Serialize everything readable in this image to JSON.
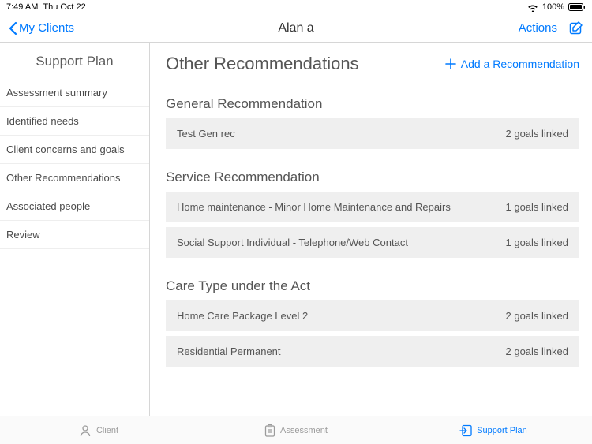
{
  "status": {
    "time": "7:49 AM",
    "date": "Thu Oct 22",
    "battery_pct": "100%"
  },
  "nav": {
    "back_label": "My Clients",
    "title": "Alan a",
    "actions_label": "Actions"
  },
  "sidebar": {
    "title": "Support Plan",
    "items": [
      {
        "label": "Assessment summary"
      },
      {
        "label": "Identified needs"
      },
      {
        "label": "Client concerns and goals"
      },
      {
        "label": "Other Recommendations"
      },
      {
        "label": "Associated people"
      },
      {
        "label": "Review"
      }
    ]
  },
  "content": {
    "title": "Other Recommendations",
    "add_label": "Add a Recommendation",
    "sections": [
      {
        "title": "General Recommendation",
        "rows": [
          {
            "text": "Test Gen rec",
            "meta": "2 goals linked"
          }
        ]
      },
      {
        "title": "Service Recommendation",
        "rows": [
          {
            "text": "Home maintenance - Minor Home Maintenance and Repairs",
            "meta": "1 goals linked"
          },
          {
            "text": "Social Support Individual - Telephone/Web Contact",
            "meta": "1 goals linked"
          }
        ]
      },
      {
        "title": "Care Type under the Act",
        "rows": [
          {
            "text": "Home Care Package Level 2",
            "meta": "2 goals linked"
          },
          {
            "text": "Residential Permanent",
            "meta": "2 goals linked"
          }
        ]
      }
    ]
  },
  "tabs": {
    "client": "Client",
    "assessment": "Assessment",
    "support_plan": "Support Plan"
  }
}
